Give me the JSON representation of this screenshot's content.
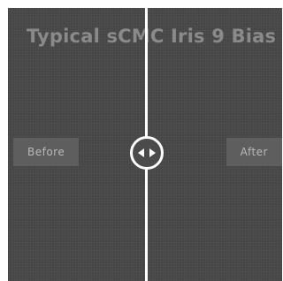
{
  "overlay": {
    "title": "Typical sCMC Iris 9 Bias",
    "before_label": "Before",
    "after_label": "After"
  },
  "slider": {
    "position_percent": 50,
    "handle_icon": "left-right-arrows-icon"
  },
  "colors": {
    "background": "#4b4b4b",
    "label_bg": "#5e5e5e",
    "divider": "#ffffff",
    "title_text": "#8a8a8a"
  }
}
